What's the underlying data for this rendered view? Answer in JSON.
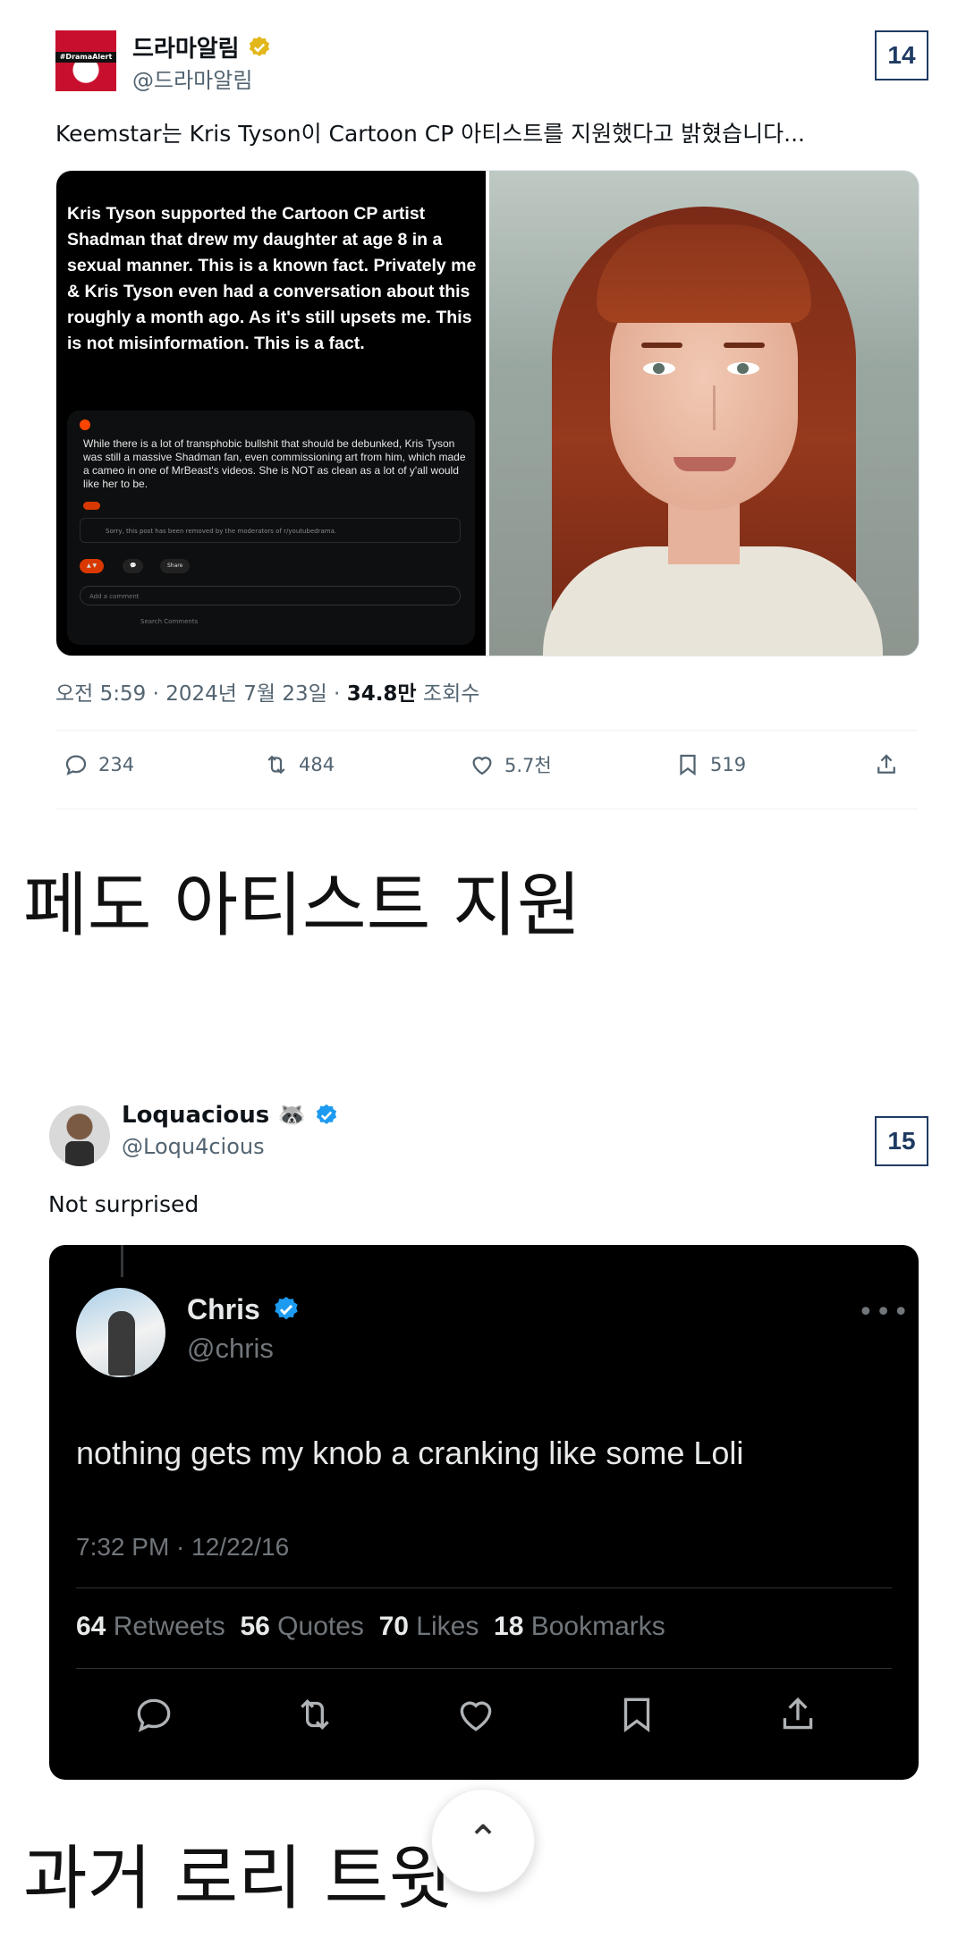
{
  "tweet1": {
    "display_name": "드라마알림",
    "handle": "@드라마알림",
    "index_badge": "14",
    "text": "Keemstar는 Kris Tyson이 Cartoon CP 아티스트를 지원했다고 밝혔습니다...",
    "media_quote": "Kris Tyson supported the Cartoon CP artist Shadman that drew my daughter at age 8 in a sexual manner. This is a known fact. Privately me & Kris Tyson even had a conversation about this roughly a month ago. As it's still upsets me. This is not misinformation. This is a fact.",
    "reddit_post": "While there is a lot of transphobic bullshit that should be debunked, Kris Tyson was still a massive Shadman fan, even commissioning art from him, which made a cameo in one of MrBeast's videos. She is NOT as clean as a lot of y'all would like her to be.",
    "reddit_notice": "Sorry, this post has been removed by the moderators of r/youtubedrama.",
    "reddit_comment_placeholder": "Add a comment",
    "reddit_search": "Search Comments",
    "reddit_share": "Share",
    "meta_time": "오전 5:59 · 2024년 7월 23일 · ",
    "meta_views": "34.8만",
    "meta_views_label": " 조회수",
    "replies": "234",
    "retweets": "484",
    "likes": "5.7천",
    "bookmarks": "519"
  },
  "caption1": "페도 아티스트 지원",
  "tweet2": {
    "display_name": "Loquacious 🦝",
    "handle": "@Loqu4cious",
    "index_badge": "15",
    "text": "Not surprised",
    "quoted": {
      "display_name": "Chris",
      "handle": "@chris",
      "text": "nothing gets my knob a cranking like some Loli",
      "time": "7:32 PM · 12/22/16",
      "retweets_count": "64",
      "retweets_label": "Retweets",
      "quotes_count": "56",
      "quotes_label": "Quotes",
      "likes_count": "70",
      "likes_label": "Likes",
      "bookmarks_count": "18",
      "bookmarks_label": "Bookmarks"
    }
  },
  "caption2": "과거 로리 트윗",
  "colors": {
    "verified_blue": "#1d9bf0",
    "verified_gold": "#e2b719",
    "muted": "#536471"
  }
}
